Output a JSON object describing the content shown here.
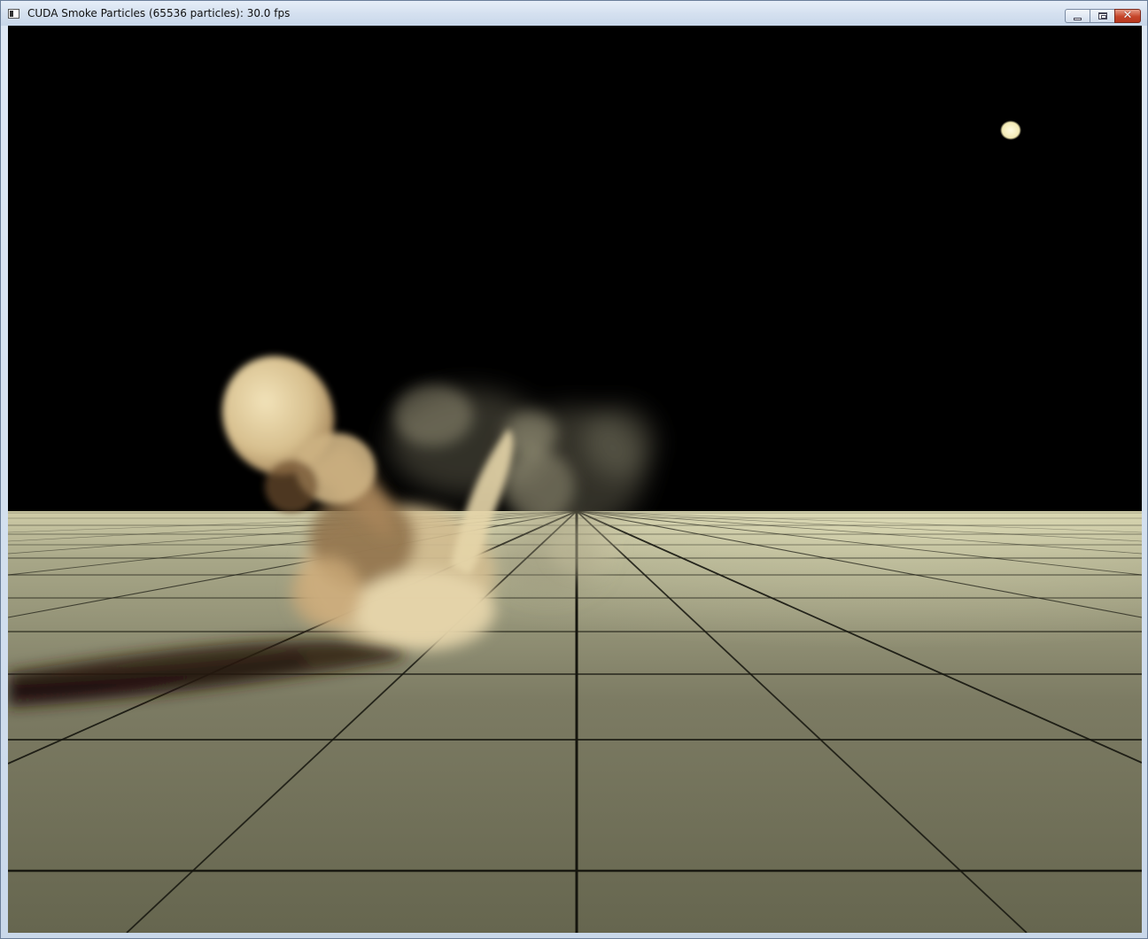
{
  "window": {
    "title": "CUDA Smoke Particles (65536 particles): 30.0 fps",
    "icon": "app-window-icon",
    "buttons": {
      "minimize": "minimize-icon",
      "maximize": "maximize-icon",
      "close": "close-icon",
      "close_glyph": "✕"
    }
  },
  "scene": {
    "colors": {
      "sky": "#000000",
      "floor_far": "#c8c6a2",
      "floor_near": "#6a6a55",
      "grid_line": "#1a1a12",
      "smoke_light": "#e9d8ae",
      "smoke_dark": "#8a6a45",
      "shadow": "#3a2410",
      "light_source": "#fbf4c8"
    }
  }
}
